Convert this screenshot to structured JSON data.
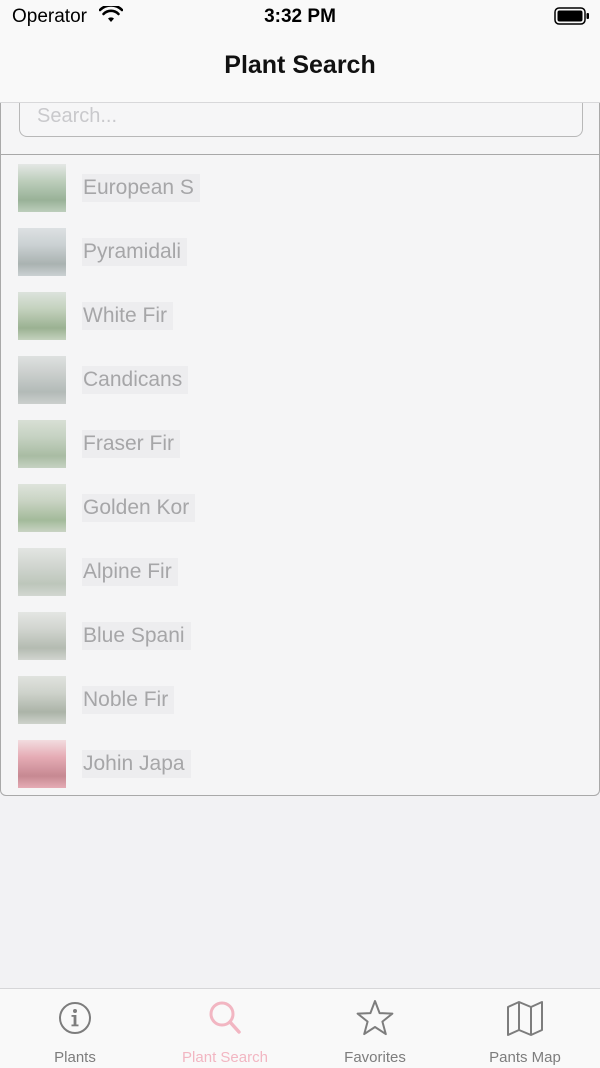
{
  "status_bar": {
    "carrier": "Operator",
    "time": "3:32 PM"
  },
  "nav": {
    "title": "Plant Search"
  },
  "search": {
    "placeholder": "Search..."
  },
  "plants": [
    {
      "name": "European S",
      "thumb_colors": [
        "#8fae8c",
        "#4d7a4a",
        "#d6dcd7"
      ]
    },
    {
      "name": "Pyramidali",
      "thumb_colors": [
        "#a8b3b6",
        "#6c7c78",
        "#c9d0d2"
      ]
    },
    {
      "name": "White Fir",
      "thumb_colors": [
        "#9cb590",
        "#517a40",
        "#c7d4c7"
      ]
    },
    {
      "name": "Candicans",
      "thumb_colors": [
        "#a9b0ac",
        "#7c8a84",
        "#cbd0ce"
      ]
    },
    {
      "name": "Fraser Fir",
      "thumb_colors": [
        "#9fb598",
        "#6a8d5f",
        "#c0cdb9"
      ]
    },
    {
      "name": "Golden Kor",
      "thumb_colors": [
        "#a5b89a",
        "#5f8a4f",
        "#cbd6c6"
      ]
    },
    {
      "name": "Alpine Fir",
      "thumb_colors": [
        "#b5bdb3",
        "#8fa08a",
        "#d4d9d2"
      ]
    },
    {
      "name": "Blue Spani",
      "thumb_colors": [
        "#b4bab0",
        "#7f8c79",
        "#d6dad3"
      ]
    },
    {
      "name": "Noble Fir",
      "thumb_colors": [
        "#aeb6a8",
        "#6f7e68",
        "#cfd4cb"
      ]
    },
    {
      "name": "Johin Japa",
      "thumb_colors": [
        "#d97080",
        "#a03040",
        "#f0c8cc"
      ]
    }
  ],
  "tabs": [
    {
      "label": "Plants",
      "icon": "info-circle-icon",
      "active": false
    },
    {
      "label": "Plant Search",
      "icon": "search-icon",
      "active": true
    },
    {
      "label": "Favorites",
      "icon": "star-icon",
      "active": false
    },
    {
      "label": "Pants Map",
      "icon": "map-icon",
      "active": false
    }
  ],
  "colors": {
    "accent": "#f2b6c2",
    "tab_inactive": "#7d7d7d",
    "label_text": "#a6a6a8"
  }
}
